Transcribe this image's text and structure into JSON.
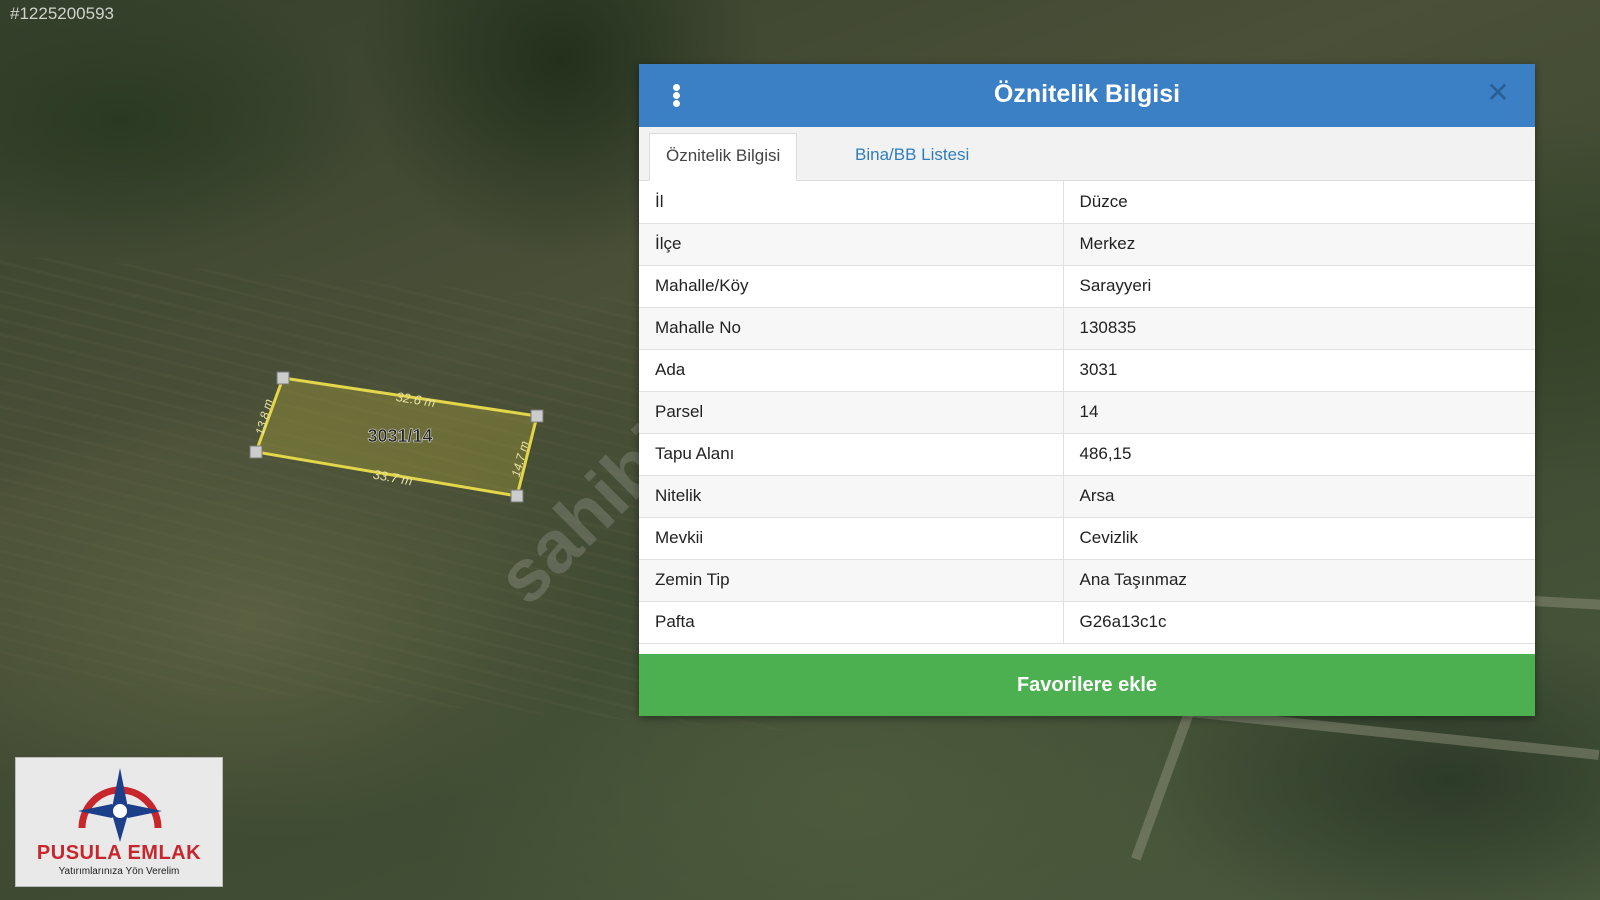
{
  "map": {
    "listing_id": "#1225200593",
    "watermark": "sahibinden",
    "parcel_label": "3031/14",
    "edge_top": "32.6 m",
    "edge_bottom": "33.7 m",
    "edge_left": "13.8 m",
    "edge_right": "14.7 m"
  },
  "panel": {
    "title": "Öznitelik Bilgisi",
    "tabs": [
      {
        "label": "Öznitelik Bilgisi",
        "active": true
      },
      {
        "label": "Bina/BB Listesi",
        "active": false
      }
    ],
    "rows": [
      {
        "key": "İl",
        "value": "Düzce"
      },
      {
        "key": "İlçe",
        "value": "Merkez"
      },
      {
        "key": "Mahalle/Köy",
        "value": "Sarayyeri"
      },
      {
        "key": "Mahalle No",
        "value": "130835"
      },
      {
        "key": "Ada",
        "value": "3031"
      },
      {
        "key": "Parsel",
        "value": "14"
      },
      {
        "key": "Tapu Alanı",
        "value": "486,15"
      },
      {
        "key": "Nitelik",
        "value": "Arsa"
      },
      {
        "key": "Mevkii",
        "value": "Cevizlik"
      },
      {
        "key": "Zemin Tip",
        "value": "Ana Taşınmaz"
      },
      {
        "key": "Pafta",
        "value": "G26a13c1c"
      }
    ],
    "favorite_button": "Favorilere ekle"
  },
  "logo": {
    "name": "PUSULA EMLAK",
    "slogan": "Yatırımlarınıza Yön Verelim"
  },
  "colors": {
    "header": "#3b7fc4",
    "button": "#4caf50",
    "tab_link": "#2e7dbf",
    "logo_red": "#c8262d",
    "logo_blue": "#1d3f8a"
  }
}
